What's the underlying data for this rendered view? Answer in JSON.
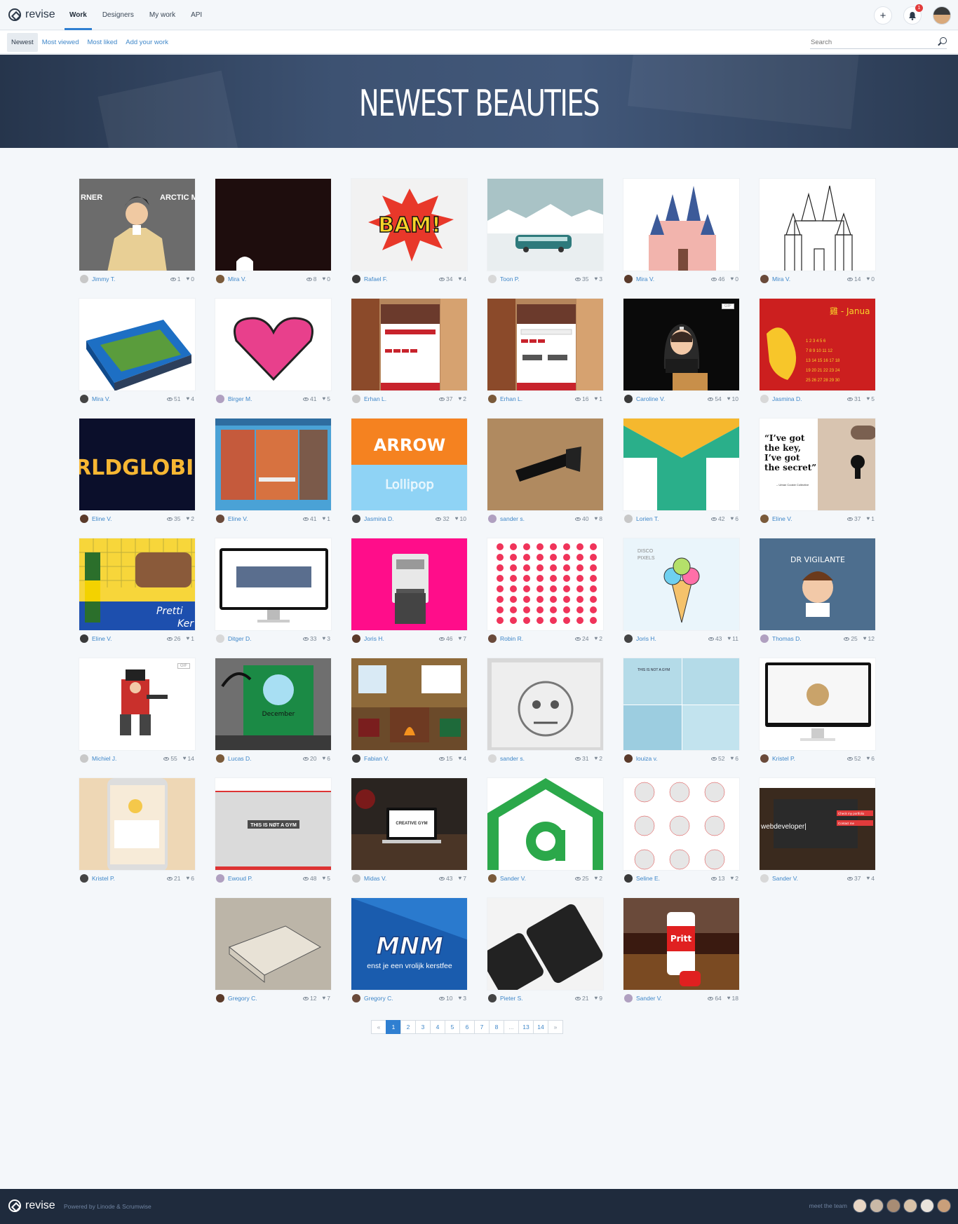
{
  "brand": "revise",
  "nav": [
    "Work",
    "Designers",
    "My work",
    "API"
  ],
  "notifications_count": "1",
  "subnav": [
    "Newest",
    "Most viewed",
    "Most liked",
    "Add your work"
  ],
  "search_placeholder": "Search",
  "hero_title": "NEWEST BEAUTIES",
  "cards": [
    {
      "user": "Jimmy T.",
      "views": "1",
      "likes": "0"
    },
    {
      "user": "Mira V.",
      "views": "8",
      "likes": "0"
    },
    {
      "user": "Rafael F.",
      "views": "34",
      "likes": "4"
    },
    {
      "user": "Toon P.",
      "views": "35",
      "likes": "3"
    },
    {
      "user": "Mira V.",
      "views": "46",
      "likes": "0"
    },
    {
      "user": "Mira V.",
      "views": "14",
      "likes": "0"
    },
    {
      "user": "Mira V.",
      "views": "51",
      "likes": "4"
    },
    {
      "user": "Birger M.",
      "views": "41",
      "likes": "5"
    },
    {
      "user": "Erhan L.",
      "views": "37",
      "likes": "2"
    },
    {
      "user": "Erhan L.",
      "views": "16",
      "likes": "1"
    },
    {
      "user": "Caroline V.",
      "views": "54",
      "likes": "10"
    },
    {
      "user": "Jasmina D.",
      "views": "31",
      "likes": "5"
    },
    {
      "user": "Eline V.",
      "views": "35",
      "likes": "2"
    },
    {
      "user": "Eline V.",
      "views": "41",
      "likes": "1"
    },
    {
      "user": "Jasmina D.",
      "views": "32",
      "likes": "10"
    },
    {
      "user": "sander s.",
      "views": "40",
      "likes": "8"
    },
    {
      "user": "Lorien T.",
      "views": "42",
      "likes": "6"
    },
    {
      "user": "Eline V.",
      "views": "37",
      "likes": "1"
    },
    {
      "user": "Eline V.",
      "views": "26",
      "likes": "1"
    },
    {
      "user": "Ditger D.",
      "views": "33",
      "likes": "3"
    },
    {
      "user": "Joris H.",
      "views": "46",
      "likes": "7"
    },
    {
      "user": "Robin R.",
      "views": "24",
      "likes": "2"
    },
    {
      "user": "Joris H.",
      "views": "43",
      "likes": "11"
    },
    {
      "user": "Thomas D.",
      "views": "25",
      "likes": "12"
    },
    {
      "user": "Michiel J.",
      "views": "55",
      "likes": "14"
    },
    {
      "user": "Lucas D.",
      "views": "20",
      "likes": "6"
    },
    {
      "user": "Fabian V.",
      "views": "15",
      "likes": "4"
    },
    {
      "user": "sander s.",
      "views": "31",
      "likes": "2"
    },
    {
      "user": "louiza v.",
      "views": "52",
      "likes": "6"
    },
    {
      "user": "Kristel P.",
      "views": "52",
      "likes": "6"
    },
    {
      "user": "Kristel P.",
      "views": "21",
      "likes": "6"
    },
    {
      "user": "Ewoud P.",
      "views": "48",
      "likes": "5"
    },
    {
      "user": "Midas V.",
      "views": "43",
      "likes": "7"
    },
    {
      "user": "Sander V.",
      "views": "25",
      "likes": "2"
    },
    {
      "user": "Seline E.",
      "views": "13",
      "likes": "2"
    },
    {
      "user": "Sander V.",
      "views": "37",
      "likes": "4"
    },
    {
      "user": "Gregory C.",
      "views": "12",
      "likes": "7"
    },
    {
      "user": "Gregory C.",
      "views": "10",
      "likes": "3"
    },
    {
      "user": "Pieter S.",
      "views": "21",
      "likes": "9"
    },
    {
      "user": "Sander V.",
      "views": "64",
      "likes": "18"
    }
  ],
  "thumb_text": {
    "c0_left": "RNER",
    "c0_right": "ARCTIC M",
    "c2": "BAM!",
    "c11": "雞 - Janua",
    "c12": "RLDGLOBI",
    "c14_top": "ARROW",
    "c14_bottom": "Lollipop",
    "c17_quote": "“I’ve got the key, I’ve got the secret”",
    "c17_author": "– Urban Cookie Collective",
    "c18_text": "Pretti Ker",
    "c22": "DISCO PIXELS",
    "c23": "DR VIGILANTE",
    "c25": "December",
    "c28": "THIS IS NOT A GYM",
    "c31": "THIS IS NØT A GYM",
    "c32": "CREATIVE GYM",
    "c35_a": "webdeveloper|",
    "c35_b": "Check my portfolio",
    "c35_c": "Contact me",
    "c37_a": "MNM",
    "c37_b": "enst je een vrolijk kerstfee",
    "c39": "Pritt"
  },
  "gif_label": "GIF",
  "pagination": [
    "«",
    "1",
    "2",
    "3",
    "4",
    "5",
    "6",
    "7",
    "8",
    "...",
    "13",
    "14",
    "»"
  ],
  "footer": {
    "brand": "revise",
    "powered": "Powered by Linode & Scrumwise",
    "team_label": "meet the team"
  },
  "colors": {
    "accent": "#2f7fd1",
    "link": "#3f87c9",
    "footer_bg": "#1f2b3d"
  }
}
